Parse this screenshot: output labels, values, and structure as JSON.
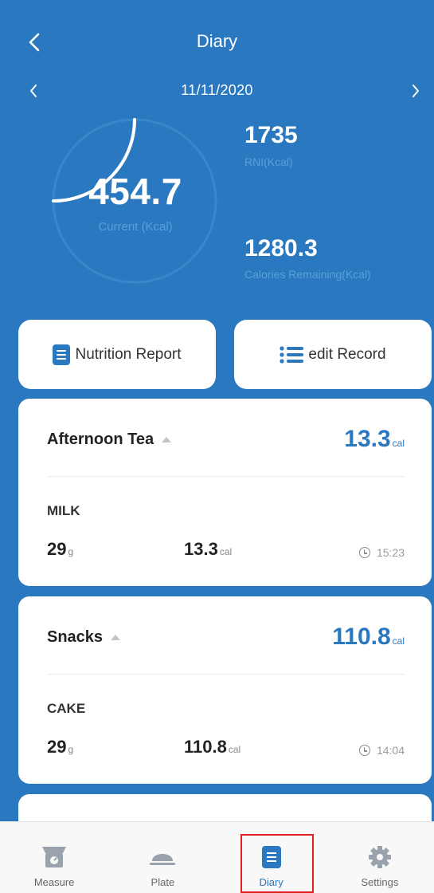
{
  "header": {
    "title": "Diary",
    "date": "11/11/2020"
  },
  "summary": {
    "current_value": "454.7",
    "current_label": "Current (Kcal)",
    "current_progress": 0.25,
    "rni_value": "1735",
    "rni_label": "RNI(Kcal)",
    "remaining_value": "1280.3",
    "remaining_label": "Calories Remaining(Kcal)"
  },
  "actions": {
    "report_label": "Nutrition Report",
    "edit_label": "edit Record"
  },
  "meals": [
    {
      "name": "Afternoon Tea",
      "total": "13.3",
      "total_unit": "cal",
      "food": "MILK",
      "weight": "29",
      "weight_unit": "g",
      "kcal": "13.3",
      "kcal_unit": "cal",
      "time": "15:23"
    },
    {
      "name": "Snacks",
      "total": "110.8",
      "total_unit": "cal",
      "food": "CAKE",
      "weight": "29",
      "weight_unit": "g",
      "kcal": "110.8",
      "kcal_unit": "cal",
      "time": "14:04"
    }
  ],
  "tabs": [
    {
      "label": "Measure",
      "icon": "scale-icon"
    },
    {
      "label": "Plate",
      "icon": "plate-icon"
    },
    {
      "label": "Diary",
      "icon": "diary-icon",
      "active": true
    },
    {
      "label": "Settings",
      "icon": "gear-icon"
    }
  ],
  "colors": {
    "primary": "#2978c0",
    "active_highlight": "#e02020"
  }
}
